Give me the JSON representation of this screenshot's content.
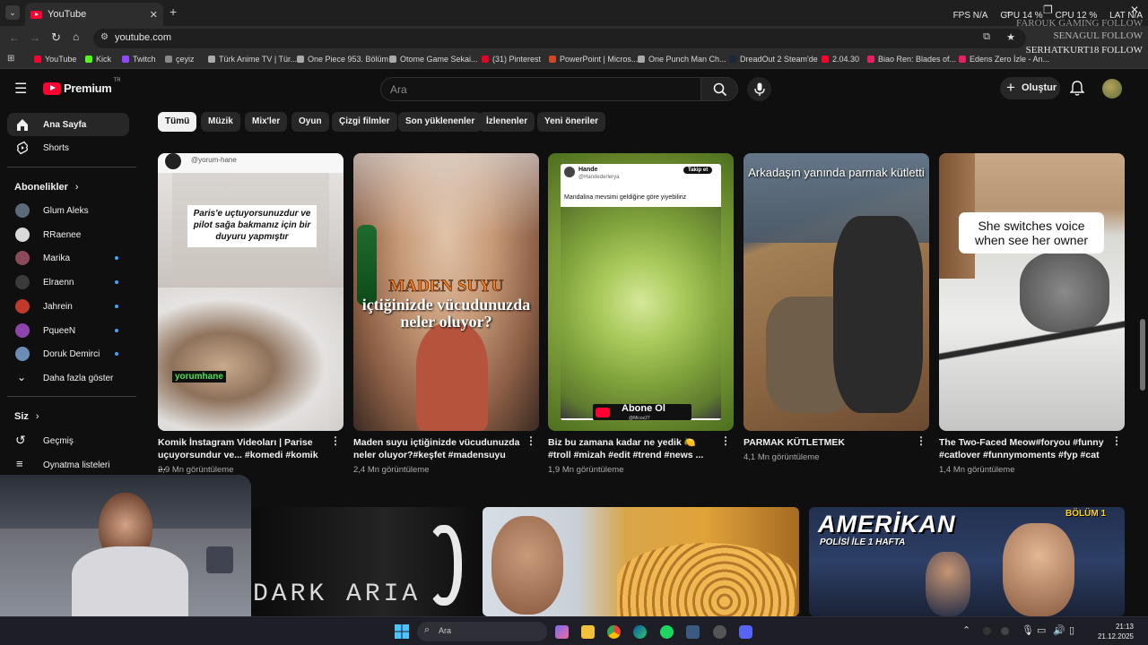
{
  "browser": {
    "tab_title": "YouTube",
    "url": "youtube.com",
    "bookmarks": [
      {
        "label": "YouTube",
        "color": "#ff0033"
      },
      {
        "label": "Kick",
        "color": "#53fc18"
      },
      {
        "label": "Twitch",
        "color": "#9146ff"
      },
      {
        "label": "çeyiz",
        "color": "#888888"
      },
      {
        "label": "Türk Anime TV | Tür...",
        "color": "#aaaaaa"
      },
      {
        "label": "One Piece 953. Bölüm",
        "color": "#aaaaaa"
      },
      {
        "label": "Otome Game Sekai...",
        "color": "#aaaaaa"
      },
      {
        "label": "(31) Pinterest",
        "color": "#e60023"
      },
      {
        "label": "PowerPoint | Micros...",
        "color": "#d24726"
      },
      {
        "label": "One Punch Man Ch...",
        "color": "#aaaaaa"
      },
      {
        "label": "DreadOut 2 Steam'de",
        "color": "#1b2838"
      },
      {
        "label": "2.04.30",
        "color": "#ff0033"
      },
      {
        "label": "Biao Ren: Blades of...",
        "color": "#e91e63"
      },
      {
        "label": "Edens Zero İzle - An...",
        "color": "#e91e63"
      }
    ],
    "overlay": {
      "fps": "FPS  N/A",
      "gpu": "GPU  14 %",
      "cpu": "CPU  12 %",
      "lat": "LAT  N/A",
      "line1": "FAROUK GAMING FOLLOW",
      "line2": "SENAGUL FOLLOW",
      "line3": "SERHATKURT18 FOLLOW"
    }
  },
  "header": {
    "logo": "Premium",
    "logo_tr": "TR",
    "search_placeholder": "Ara",
    "create_label": "Oluştur"
  },
  "sidebar": {
    "home": "Ana Sayfa",
    "shorts": "Shorts",
    "subscriptions_title": "Abonelikler",
    "subscriptions": [
      {
        "label": "Glum Aleks",
        "dot": false,
        "color": "#5b6b7a"
      },
      {
        "label": "RRaenee",
        "dot": false,
        "color": "#d9d9d9"
      },
      {
        "label": "Marika",
        "dot": true,
        "color": "#8b4a5a"
      },
      {
        "label": "Elraenn",
        "dot": true,
        "color": "#3a3a3a"
      },
      {
        "label": "Jahrein",
        "dot": true,
        "color": "#c0392b"
      },
      {
        "label": "PqueeN",
        "dot": true,
        "color": "#8e44ad"
      },
      {
        "label": "Doruk Demirci",
        "dot": true,
        "color": "#6b8db5"
      }
    ],
    "show_more": "Daha fazla göster",
    "you_title": "Siz",
    "history": "Geçmiş",
    "playlists": "Oynatma listeleri"
  },
  "chips": [
    "Tümü",
    "Müzik",
    "Mix'ler",
    "Oyun",
    "Çizgi filmler",
    "Son yüklenenler",
    "İzlenenler",
    "Yeni öneriler"
  ],
  "videos": [
    {
      "title": "Komik İnstagram Videoları | Parise uçuyorsundur ve... #komedi #komik ...",
      "views": "2,9 Mn görüntüleme",
      "thumb_text": "Paris'e uçtuyorsunuzdur ve pilot sağa bakmanız için bir duyuru yapmıştır",
      "channel_tag": "@yorum-hane",
      "watermark": "yorumhane"
    },
    {
      "title": "Maden suyu içtiğinizde vücudunuzda neler oluyor?#keşfet #madensuyu",
      "views": "2,4 Mn görüntüleme",
      "thumb_text_top": "MADEN SUYU",
      "thumb_text_bottom": "içtiğinizde vücudunuzda neler oluyor?"
    },
    {
      "title": "Biz bu zamana kadar ne yedik 🍋 #troll #mizah #edit #trend #news ...",
      "views": "1,9 Mn görüntüleme",
      "tweet_name": "Hande",
      "tweet_handle": "@Handederlerya",
      "tweet_follow": "Takip et",
      "tweet_text": "Mandalina mevsimi geldiğine göre yiyebiliriz",
      "sub_text": "Abone Ol",
      "sub_handle": "@Micoz27"
    },
    {
      "title": "PARMAK KÜTLETMEK",
      "views": "4,1 Mn görüntüleme",
      "thumb_text": "Arkadaşın yanında parmak kütletti"
    },
    {
      "title": "The Two-Faced Meow#foryou #funny #catlover #funnymoments #fyp #cat",
      "views": "1,4 Mn görüntüleme",
      "thumb_text": "She switches  voice when  see her owner"
    }
  ],
  "bottom_row": [
    {
      "thumb_text": "DARK ARIA"
    },
    {
      "thumb_text": ""
    },
    {
      "thumb_text": "AMERİKAN",
      "thumb_sub": "POLİSİ İLE 1 HAFTA",
      "badge": "BÖLÜM 1"
    }
  ],
  "taskbar": {
    "search": "Ara",
    "time": "21:13",
    "date": "21.12.2025"
  }
}
